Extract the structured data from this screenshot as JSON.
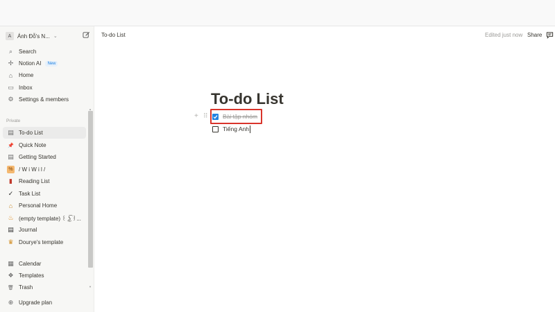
{
  "sidebar": {
    "workspace": {
      "avatar": "A",
      "name": "Ánh Đỗ's N...",
      "chevron_icon": "chevron-down-icon",
      "edit_icon": "new-page-icon"
    },
    "top_items": [
      {
        "icon": "search-icon",
        "glyph": "⌕",
        "label": "Search"
      },
      {
        "icon": "notion-ai-icon",
        "glyph": "✢",
        "label": "Notion AI",
        "badge": "New"
      },
      {
        "icon": "home-icon",
        "glyph": "⌂",
        "label": "Home"
      },
      {
        "icon": "inbox-icon",
        "glyph": "▭",
        "label": "Inbox"
      },
      {
        "icon": "gear-icon",
        "glyph": "⚙",
        "label": "Settings & members"
      }
    ],
    "private_label": "Private",
    "pages": [
      {
        "icon": "page-icon",
        "glyph": "▤",
        "label": "To-do List",
        "active": true
      },
      {
        "icon": "pushpin-icon",
        "glyph": "📌",
        "label": "Quick Note"
      },
      {
        "icon": "page-icon",
        "glyph": "▤",
        "label": "Getting Started"
      },
      {
        "icon": "percent-icon",
        "glyph": "%",
        "label": "/ W i W i l /"
      },
      {
        "icon": "book-icon",
        "glyph": "▮",
        "label": "Reading List"
      },
      {
        "icon": "checkmark-icon",
        "glyph": "✓",
        "label": "Task List"
      },
      {
        "icon": "house-icon",
        "glyph": "⌂",
        "label": "Personal Home"
      },
      {
        "icon": "flame-icon",
        "glyph": "♨",
        "label": "(empty template) ꒰ ͜ʖ͡ ꒱..."
      },
      {
        "icon": "journal-icon",
        "glyph": "▤",
        "label": "Journal"
      },
      {
        "icon": "crown-icon",
        "glyph": "♛",
        "label": "Dourye's template"
      }
    ],
    "bottom_items": [
      {
        "icon": "calendar-icon",
        "glyph": "▦",
        "label": "Calendar"
      },
      {
        "icon": "templates-icon",
        "glyph": "❖",
        "label": "Templates"
      },
      {
        "icon": "trash-icon",
        "glyph": "🗑",
        "label": "Trash"
      },
      {
        "icon": "upgrade-icon",
        "glyph": "⊕",
        "label": "Upgrade plan"
      }
    ]
  },
  "header": {
    "breadcrumb": "To-do List",
    "edited": "Edited just now",
    "share_label": "Share",
    "comment_icon": "comment-icon"
  },
  "page": {
    "title": "To-do List",
    "todos": [
      {
        "text": "Bài tập nhóm",
        "checked": true
      },
      {
        "text": "Tiếng Anh",
        "checked": false
      }
    ]
  },
  "colors": {
    "accent": "#2383e2",
    "highlight_box": "#d9342b",
    "sidebar_bg": "#f7f7f5"
  }
}
